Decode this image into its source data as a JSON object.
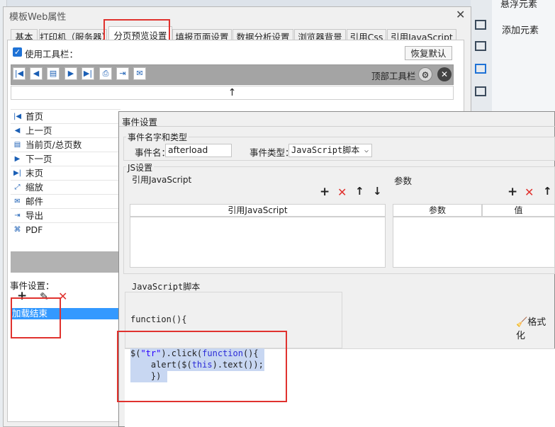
{
  "dialog": {
    "title": "模板Web属性",
    "close": "✕",
    "tabs": [
      "基本",
      "打印机（服务器）",
      "分页预览设置",
      "填报页面设置",
      "数据分析设置",
      "浏览器背景",
      "引用Css",
      "引用JavaScript"
    ]
  },
  "right_panel": {
    "items": [
      "悬浮元素",
      "添加元素"
    ]
  },
  "preview": {
    "use_toolbar_label": "使用工具栏：",
    "restore_default": "恢复默认",
    "top_toolbar_label": "顶部工具栏",
    "up_arrow": "↑",
    "toolbar_buttons": [
      {
        "icon": "first-page-icon",
        "glyph": "|◀"
      },
      {
        "icon": "prev-page-icon",
        "glyph": "◀"
      },
      {
        "icon": "page-number-icon",
        "glyph": "▤"
      },
      {
        "icon": "next-page-icon",
        "glyph": "▶"
      },
      {
        "icon": "last-page-icon",
        "glyph": "▶|"
      },
      {
        "icon": "print-icon",
        "glyph": "⎙"
      },
      {
        "icon": "export-icon",
        "glyph": "⇥"
      },
      {
        "icon": "email-icon",
        "glyph": "✉"
      }
    ],
    "list_items": [
      {
        "label": "首页",
        "icon": "first-page-icon",
        "glyph": "|◀"
      },
      {
        "label": "上一页",
        "icon": "prev-page-icon",
        "glyph": "◀"
      },
      {
        "label": "当前页/总页数",
        "icon": "page-number-icon",
        "glyph": "▤"
      },
      {
        "label": "下一页",
        "icon": "next-page-icon",
        "glyph": "▶"
      },
      {
        "label": "末页",
        "icon": "last-page-icon",
        "glyph": "▶|"
      },
      {
        "label": "缩放",
        "icon": "zoom-icon",
        "glyph": "⤢"
      },
      {
        "label": "邮件",
        "icon": "email-icon",
        "glyph": "✉"
      },
      {
        "label": "导出",
        "icon": "export-icon",
        "glyph": "⇥"
      },
      {
        "label": "PDF",
        "icon": "pdf-icon",
        "glyph": "⌘"
      }
    ],
    "event_settings_label": "事件设置：",
    "event_ops": {
      "add": "+",
      "edit": "✎",
      "delete": "✕"
    },
    "event_selected": "加载结束"
  },
  "event_dialog": {
    "title": "事件设置",
    "name_type_group": "事件名字和类型",
    "event_name_label": "事件名：",
    "event_name_value": "afterload",
    "event_type_label": "事件类型：",
    "event_type_value": "JavaScript脚本",
    "js_settings_group": "JS设置",
    "ref_js_label": "引用JavaScript",
    "params_label": "参数",
    "ops": {
      "add": "+",
      "delete": "✕",
      "up": "↑",
      "down": "↓"
    },
    "ref_js_col": "引用JavaScript",
    "params_cols": [
      "参数",
      "值"
    ],
    "js_script_label": "JavaScript脚本",
    "function_header": "function(){",
    "format_label": "格式化",
    "code_lines": [
      {
        "p1": "$(",
        "s": "\"tr\"",
        "p2": ").click(",
        "kw": "function",
        "p3": "(){"
      },
      {
        "pre": "    alert($(",
        "kw": "this",
        "post": ").text());"
      },
      {
        "text": "    })"
      }
    ]
  },
  "colors": {
    "accent": "#1e72d6",
    "selection": "#3399ff",
    "highlight_box": "#e0322e",
    "code_selection": "#c8d7f2"
  }
}
